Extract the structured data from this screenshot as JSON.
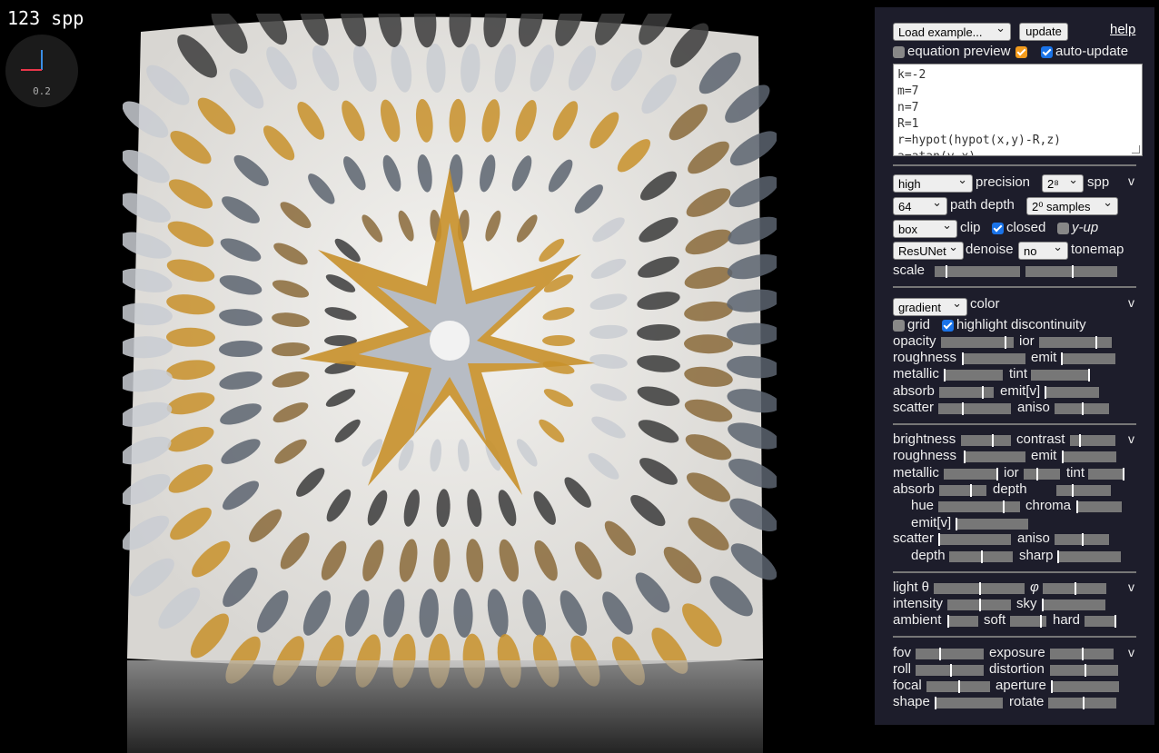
{
  "hud": {
    "spp_text": "123 spp",
    "gizmo_scale": "0.2"
  },
  "top": {
    "example_select": "Load example...",
    "update_button": "update",
    "help_link": "help",
    "equation_preview_label": "equation preview",
    "auto_update_label": "auto-update",
    "equation_preview_checked": false,
    "auto_update_checked": true,
    "code_lines": [
      "k=-2",
      "m=7",
      "n=7",
      "R=1",
      "r=hypot(hypot(x,y)-R,z)",
      "a=atan(y,x)"
    ]
  },
  "render": {
    "precision_select": "high",
    "precision_label": "precision",
    "spp_select": "2⁸",
    "spp_label": "spp",
    "path_depth_select": "64",
    "path_depth_label": "path depth",
    "samples_select": "2⁰ samples",
    "clip_select": "box",
    "clip_label": "clip",
    "closed_label": "closed",
    "closed_checked": true,
    "yup_label": "y-up",
    "yup_checked": false,
    "denoise_select": "ResUNet",
    "denoise_label": "denoise",
    "tonemap_select": "no",
    "tonemap_label": "tonemap",
    "scale_label": "scale",
    "collapse": "v"
  },
  "material": {
    "color_select": "gradient",
    "color_label": "color",
    "grid_label": "grid",
    "grid_checked": false,
    "highlight_label": "highlight discontinuity",
    "highlight_checked": true,
    "labels": {
      "opacity": "opacity",
      "ior": "ior",
      "roughness": "roughness",
      "emit": "emit",
      "metallic": "metallic",
      "tint": "tint",
      "absorb": "absorb",
      "emitv": "emit[v]",
      "scatter": "scatter",
      "aniso": "aniso"
    },
    "collapse": "v"
  },
  "surface": {
    "labels": {
      "brightness": "brightness",
      "contrast": "contrast",
      "roughness": "roughness",
      "emit": "emit",
      "metallic": "metallic",
      "ior": "ior",
      "tint": "tint",
      "absorb": "absorb",
      "depth": "depth",
      "hue": "hue",
      "chroma": "chroma",
      "emitv": "emit[v]",
      "scatter": "scatter",
      "aniso": "aniso",
      "depth2": "depth",
      "sharp": "sharp"
    },
    "collapse": "v"
  },
  "light": {
    "labels": {
      "theta": "light θ",
      "phi": "φ",
      "intensity": "intensity",
      "sky": "sky",
      "ambient": "ambient",
      "soft": "soft",
      "hard": "hard"
    },
    "collapse": "v"
  },
  "camera": {
    "labels": {
      "fov": "fov",
      "exposure": "exposure",
      "roll": "roll",
      "distortion": "distortion",
      "focal": "focal",
      "aperture": "aperture",
      "shape": "shape",
      "rotate": "rotate"
    },
    "collapse": "v"
  },
  "colors": {
    "panel_bg": "#1d1d2b",
    "gold": "#c8902a",
    "silver": "#c9ccd2",
    "white": "#ecebe8",
    "checkbox_blue": "#1a73e8",
    "checkbox_orange": "#f29b1d"
  },
  "slider_values": {
    "scale_a": 0.13,
    "scale_b": 0.5,
    "opacity": 0.88,
    "ior": 0.78,
    "roughness": 0.0,
    "emit": 0.0,
    "metallic": 0.0,
    "tint": 1.0,
    "absorb": 0.78,
    "emitv": 0.0,
    "scatter": 0.33,
    "aniso": 0.5,
    "brightness": 0.62,
    "contrast": 0.2,
    "s_roughness": 0.0,
    "s_emit": 0.0,
    "s_metallic": 0.97,
    "s_ior": 0.35,
    "s_tint": 0.97,
    "s_absorb": 0.65,
    "s_depth": 0.28,
    "hue": 0.79,
    "chroma": 0.0,
    "s_emitv": 0.0,
    "s_scatter": 0.0,
    "s_aniso": 0.5,
    "s_depth2": 0.5,
    "sharp": 0.0,
    "theta": 0.5,
    "phi": 0.5,
    "intensity": 0.5,
    "sky": 0.0,
    "ambient": 0.0,
    "soft": 0.82,
    "hard": 1.0,
    "fov": 0.35,
    "exposure": 0.5,
    "roll": 0.5,
    "distortion": 0.5,
    "focal": 0.5,
    "aperture": 0.0,
    "shape": 0.0,
    "rotate": 0.5
  }
}
